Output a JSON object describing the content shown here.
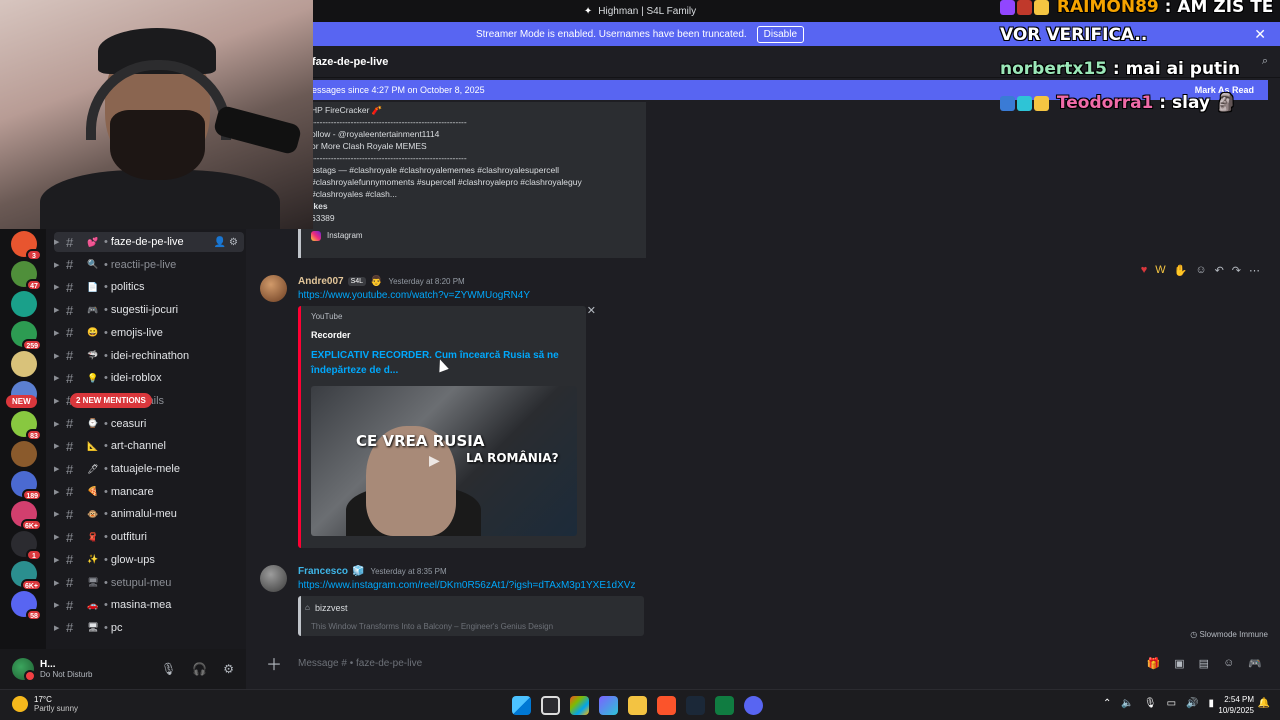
{
  "titlebar": {
    "title": "Highman | S4L Family"
  },
  "banner": {
    "text": "Streamer Mode is enabled. Usernames have been truncated.",
    "button": "Disable"
  },
  "channel_header": {
    "title": "faze-de-pe-live"
  },
  "new_messages": {
    "text": "essages since 4:27 PM on October 8, 2025",
    "mark_read": "Mark As Read"
  },
  "previous_embed": {
    "lines": [
      "HP FireCracker 🧨",
      "-------------------------------------------------------",
      "ollow - @royaleentertainment1114",
      "or More Clash Royale MEMES",
      "-------------------------------------------------------",
      "astags — #clashroyale #clashroyalememes #clashroyalesupercell",
      "#clashroyalefunnymoments #supercell #clashroyalepro #clashroyaleguy",
      "#clashroyales #clash...",
      "ikes",
      "63389"
    ],
    "source": "Instagram"
  },
  "messages": [
    {
      "author": "Andre007",
      "tag": "S4L",
      "time": "Yesterday at 8:20 PM",
      "link": "https://www.youtube.com/watch?v=ZYWMUogRN4Y",
      "embed": {
        "provider": "YouTube",
        "author": "Recorder",
        "title": "EXPLICATIV RECORDER. Cum încearcă Rusia să ne îndepărteze de d...",
        "thumb_text_1": "CE VREA RUSIA",
        "thumb_text_2": "LA ROMÂNIA?"
      }
    },
    {
      "author": "Francesco",
      "time": "Yesterday at 8:35 PM",
      "link": "https://www.instagram.com/reel/DKm0R56zAt1/?igsh=dTAxM3p1YXE1dXVz",
      "embed": {
        "author": "bizzvest",
        "desc": "This Window Transforms Into a Balcony – Engineer's Genius Design"
      }
    }
  ],
  "slowmode": "Slowmode Immune",
  "composer": {
    "placeholder": "Message #  •  faze-de-pe-live"
  },
  "channels": [
    {
      "name": "faze-de-pe-live",
      "emoji": "💕",
      "active": true,
      "muted": false
    },
    {
      "name": "reactii-pe-live",
      "emoji": "🔍",
      "active": false,
      "muted": true
    },
    {
      "name": "politics",
      "emoji": "📄",
      "active": false,
      "muted": false
    },
    {
      "name": "sugestii-jocuri",
      "emoji": "🎮",
      "active": false,
      "muted": false
    },
    {
      "name": "emojis-live",
      "emoji": "😀",
      "active": false,
      "muted": false
    },
    {
      "name": "idei-rechinathon",
      "emoji": "🦈",
      "active": false,
      "muted": false
    },
    {
      "name": "idei-roblox",
      "emoji": "💡",
      "active": false,
      "muted": false
    },
    {
      "name": "thumbnails",
      "emoji": "🎨",
      "active": false,
      "muted": true
    },
    {
      "name": "ceasuri",
      "emoji": "⌚",
      "active": false,
      "muted": false
    },
    {
      "name": "art-channel",
      "emoji": "📐",
      "active": false,
      "muted": false
    },
    {
      "name": "tatuajele-mele",
      "emoji": "🖊",
      "active": false,
      "muted": false
    },
    {
      "name": "mancare",
      "emoji": "🍕",
      "active": false,
      "muted": false
    },
    {
      "name": "animalul-meu",
      "emoji": "🐵",
      "active": false,
      "muted": false
    },
    {
      "name": "outfituri",
      "emoji": "🧣",
      "active": false,
      "muted": false
    },
    {
      "name": "glow-ups",
      "emoji": "✨",
      "active": false,
      "muted": false
    },
    {
      "name": "setupul-meu",
      "emoji": "🖥",
      "active": false,
      "muted": true
    },
    {
      "name": "masina-mea",
      "emoji": "🚗",
      "active": false,
      "muted": false
    },
    {
      "name": "pc",
      "emoji": "🖥",
      "active": false,
      "muted": false
    }
  ],
  "mentions_pill": "2 NEW MENTIONS",
  "servers": [
    {
      "color": "#e8552f",
      "badge": "3"
    },
    {
      "color": "#4f8f3a",
      "badge": "47"
    },
    {
      "color": "#1aa08a",
      "badge": ""
    },
    {
      "color": "#2d9b52",
      "badge": "259"
    },
    {
      "color": "#d9c27a",
      "badge": ""
    },
    {
      "color": "#5b7fd1",
      "badge": ""
    },
    {
      "color": "#88c840",
      "badge": "83"
    },
    {
      "color": "#8a5a2c",
      "badge": ""
    },
    {
      "color": "#4b6ad1",
      "badge": "189"
    },
    {
      "color": "#d23f6e",
      "badge": "6K+"
    },
    {
      "color": "#2b2b30",
      "badge": "1"
    },
    {
      "color": "#2b8f8f",
      "badge": "6K+"
    },
    {
      "color": "#5865f2",
      "badge": "58"
    }
  ],
  "new_pill": "NEW",
  "user": {
    "name": "H...",
    "status": "Do Not Disturb"
  },
  "overlay": [
    {
      "user": "RAIMON89",
      "text": " : AM ZIS TE"
    },
    {
      "user": "",
      "text": "VOR VERIFICA.."
    },
    {
      "user": "norbertx15",
      "text": " : mai ai putin"
    },
    {
      "user": "Teodorra1",
      "text": " : slay 🗿"
    }
  ],
  "weather": {
    "temp": "17°C",
    "desc": "Partly sunny"
  },
  "clock": {
    "time": "2:54 PM",
    "date": "10/9/2025"
  }
}
